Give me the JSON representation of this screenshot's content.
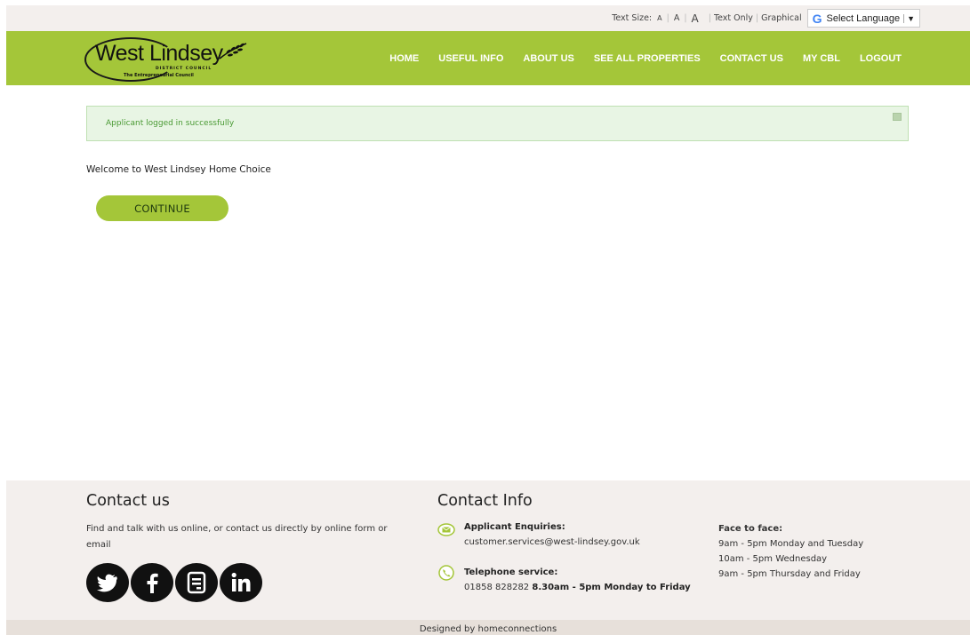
{
  "topbar": {
    "text_size_label": "Text Size:",
    "size_small": "A",
    "size_medium": "A",
    "size_large": "A",
    "text_only": "Text Only",
    "graphical": "Graphical",
    "language_label": "Select Language"
  },
  "logo": {
    "name": "West Lindsey",
    "line1": "DISTRICT COUNCIL",
    "line2": "The Entrepreneurial Council"
  },
  "nav": {
    "items": [
      "HOME",
      "USEFUL INFO",
      "ABOUT US",
      "SEE ALL PROPERTIES",
      "CONTACT US",
      "MY CBL",
      "LOGOUT"
    ]
  },
  "alert": {
    "message": "Applicant logged in successfully"
  },
  "main": {
    "welcome": "Welcome to West Lindsey Home Choice",
    "continue_label": "CONTINUE"
  },
  "footer": {
    "contact_us": {
      "title": "Contact us",
      "text": "Find and talk with us online, or contact us directly by online form or email",
      "social": [
        "twitter-icon",
        "facebook-icon",
        "form-icon",
        "linkedin-icon"
      ]
    },
    "contact_info": {
      "title": "Contact Info",
      "applicant_label": "Applicant Enquiries:",
      "applicant_email": "customer.services@west-lindsey.gov.uk",
      "telephone_label": "Telephone service:",
      "telephone_number": "01858 828282",
      "telephone_hours": "8.30am - 5pm Monday to Friday",
      "f2f_label": "Face to face:",
      "f2f_hours": [
        "9am - 5pm Monday and Tuesday",
        "10am - 5pm Wednesday",
        "9am - 5pm Thursday and Friday"
      ]
    }
  },
  "bottom": {
    "credit": "Designed by homeconnections"
  },
  "colors": {
    "brand_green": "#a4c639",
    "footer_bg": "#f3efed",
    "alert_bg": "#e8f5e4",
    "alert_text": "#4a9a34"
  }
}
